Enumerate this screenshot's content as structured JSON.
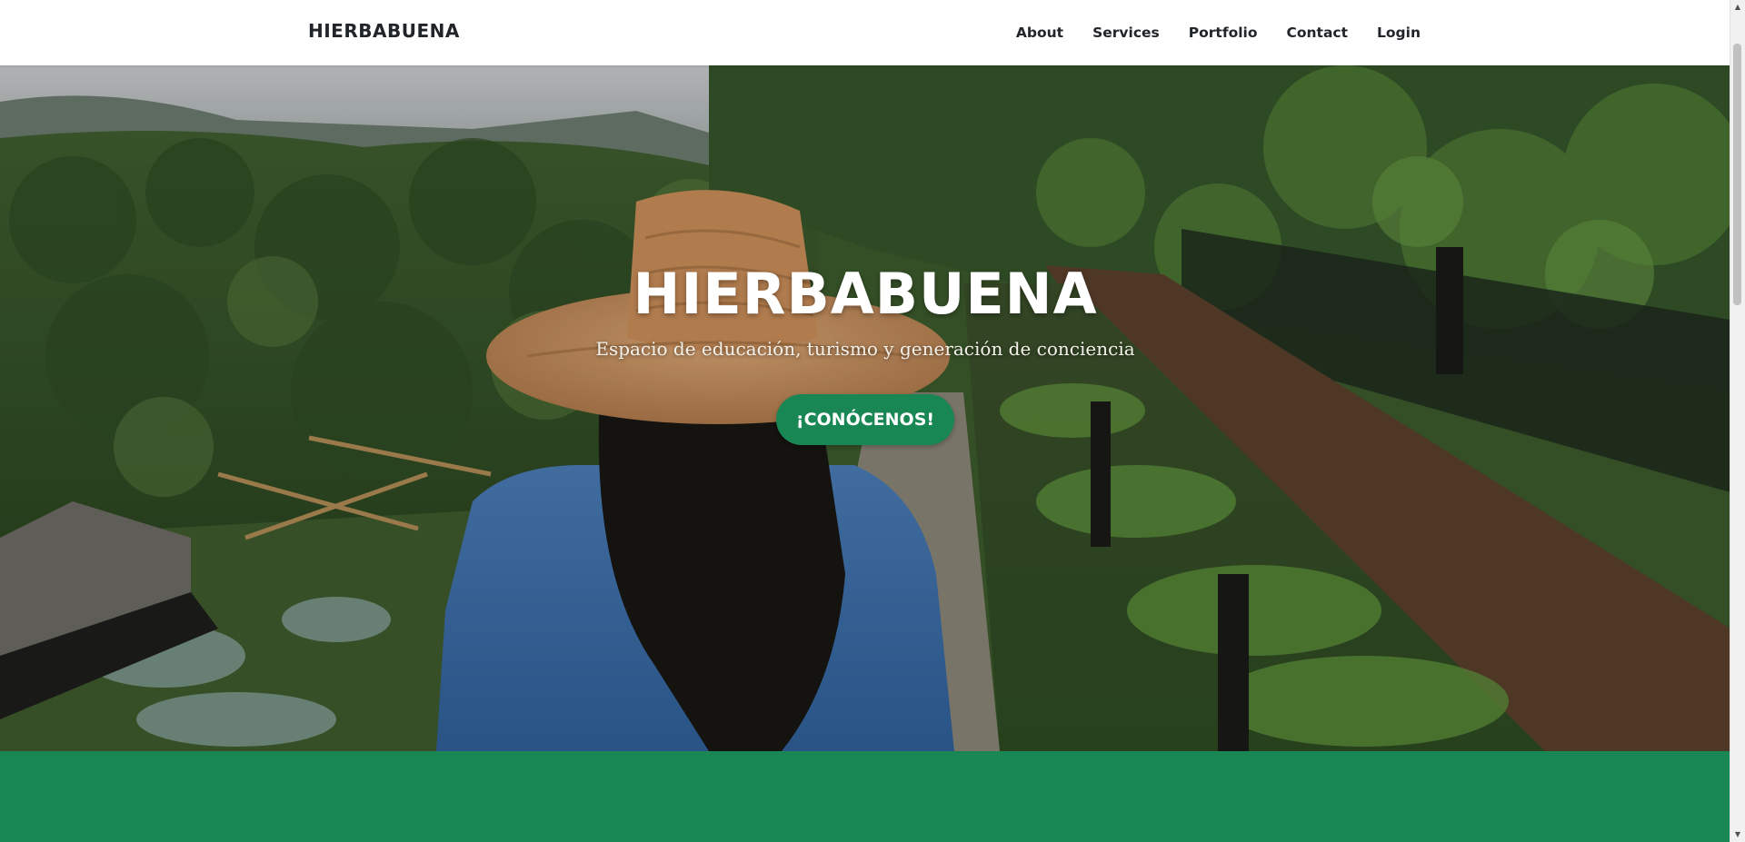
{
  "navbar": {
    "brand": "HIERBABUENA",
    "links": [
      {
        "label": "About"
      },
      {
        "label": "Services"
      },
      {
        "label": "Portfolio"
      },
      {
        "label": "Contact"
      },
      {
        "label": "Login"
      }
    ]
  },
  "hero": {
    "title": "HIERBABUENA",
    "subtitle": "Espacio de educación, turismo y generación de conciencia",
    "cta_label": "¡CONÓCENOS!"
  },
  "colors": {
    "accent": "#198754",
    "nav_text": "#212529",
    "nav_background": "#ffffff"
  },
  "icons": {
    "scroll_up": "chevron-up-icon",
    "scroll_down": "chevron-down-icon"
  }
}
